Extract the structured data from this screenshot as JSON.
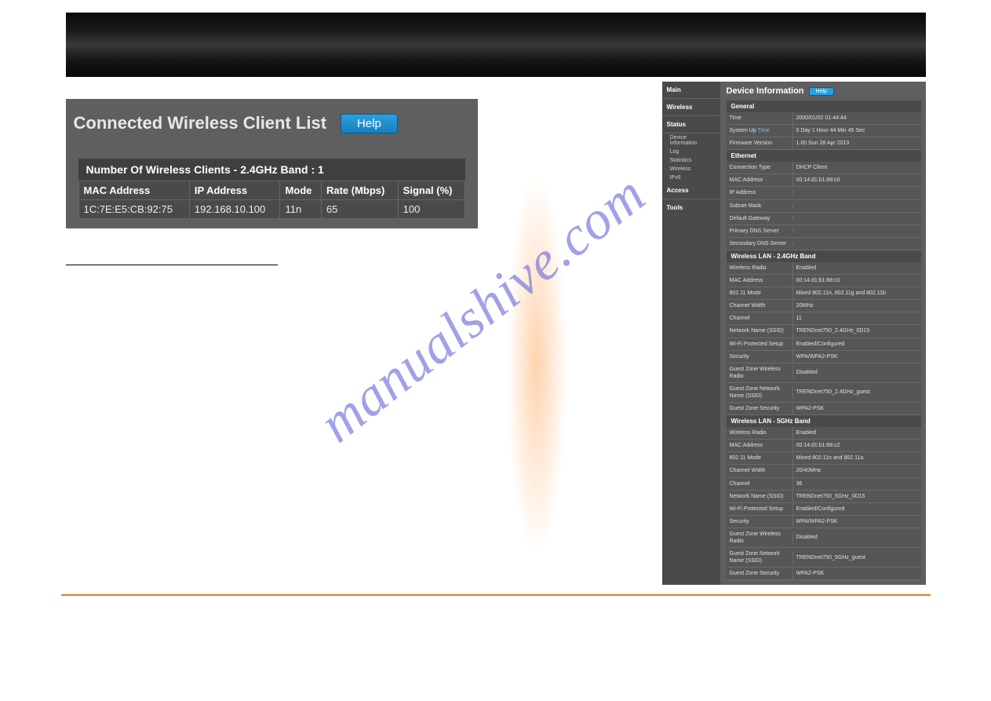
{
  "watermark": "manualshive.com",
  "left": {
    "title": "Connected Wireless Client List",
    "help": "Help",
    "band_header": "Number Of Wireless Clients - 2.4GHz Band : 1",
    "columns": [
      "MAC Address",
      "IP Address",
      "Mode",
      "Rate (Mbps)",
      "Signal (%)"
    ],
    "rows": [
      {
        "mac": "1C:7E:E5:CB:92:75",
        "ip": "192.168.10.100",
        "mode": "11n",
        "rate": "65",
        "signal": "100"
      }
    ]
  },
  "right": {
    "title": "Device Information",
    "help": "Help",
    "nav": {
      "main": "Main",
      "wireless": "Wireless",
      "status": "Status",
      "status_items": [
        "Device Information",
        "Log",
        "Statistics",
        "Wireless",
        "IPv6"
      ],
      "access": "Access",
      "tools": "Tools"
    },
    "sections": [
      {
        "header": "General",
        "rows": [
          {
            "label": "Time",
            "value": "2000/01/02 01:44:44"
          },
          {
            "label": "System Up Time",
            "value": "0 Day 1 Hour 44 Min 45 Sec",
            "label_link": "Time"
          },
          {
            "label": "Firmware Version",
            "value": "1.00 Sun 28 Apr 2013"
          }
        ]
      },
      {
        "header": "Ethernet",
        "rows": [
          {
            "label": "Connection Type",
            "value": "DHCP Client"
          },
          {
            "label": "MAC Address",
            "value": "00:14:d1:b1:88:c0"
          },
          {
            "label": "IP Address",
            "value": ""
          },
          {
            "label": "Subnet Mask",
            "value": ""
          },
          {
            "label": "Default Gateway",
            "value": ""
          },
          {
            "label": "Primary DNS Server",
            "value": ""
          },
          {
            "label": "Secondary DNS Server",
            "value": ""
          }
        ]
      },
      {
        "header": "Wireless LAN - 2.4GHz Band",
        "rows": [
          {
            "label": "Wireless Radio",
            "value": "Enabled"
          },
          {
            "label": "MAC Address",
            "value": "00:14:d1:b1:88:c0"
          },
          {
            "label": "802.11 Mode",
            "value": "Mixed 802.11n, 802.11g and 802.11b"
          },
          {
            "label": "Channel Width",
            "value": "20MHz"
          },
          {
            "label": "Channel",
            "value": "11"
          },
          {
            "label": "Network Name (SSID)",
            "value": "TRENDnet750_2.4GHz_0D15"
          },
          {
            "label": "Wi-Fi Protected Setup",
            "value": "Enabled/Configured"
          },
          {
            "label": "Security",
            "value": "WPA/WPA2-PSK"
          },
          {
            "label": "Guest Zone Wireless Radio",
            "value": "Disabled"
          },
          {
            "label": "Guest Zone Network Name (SSID)",
            "value": "TRENDnet750_2.4GHz_guest"
          },
          {
            "label": "Guest Zone Security",
            "value": "WPA2-PSK"
          }
        ]
      },
      {
        "header": "Wireless LAN - 5GHz Band",
        "rows": [
          {
            "label": "Wireless Radio",
            "value": "Enabled"
          },
          {
            "label": "MAC Address",
            "value": "00:14:d1:b1:88:c2"
          },
          {
            "label": "802.11 Mode",
            "value": "Mixed 802.11n and 802.11a"
          },
          {
            "label": "Channel Width",
            "value": "20/40MHz"
          },
          {
            "label": "Channel",
            "value": "36"
          },
          {
            "label": "Network Name (SSID)",
            "value": "TRENDnet750_5GHz_0D15"
          },
          {
            "label": "Wi-Fi Protected Setup",
            "value": "Enabled/Configured"
          },
          {
            "label": "Security",
            "value": "WPA/WPA2-PSK"
          },
          {
            "label": "Guest Zone Wireless Radio",
            "value": "Disabled"
          },
          {
            "label": "Guest Zone Network Name (SSID)",
            "value": "TRENDnet750_5GHz_guest"
          },
          {
            "label": "Guest Zone Security",
            "value": "WPA2-PSK"
          }
        ]
      }
    ]
  }
}
